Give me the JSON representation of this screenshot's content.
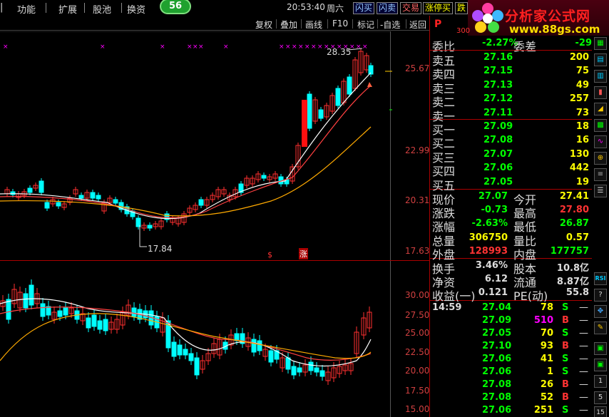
{
  "menu": {
    "items": [
      "功能",
      "扩展",
      "股池",
      "换资"
    ],
    "badge": "56",
    "clock": "20:53:40",
    "weekday": "周六"
  },
  "trade_buttons": [
    "闪买",
    "闪卖",
    "交易",
    "涨停买",
    "跌"
  ],
  "logo": {
    "title": "分析家公式网",
    "url": "www.88gs.com"
  },
  "toolbar": [
    "复权",
    "叠加",
    "画线",
    "F10",
    "标记",
    "-自选",
    "返回"
  ],
  "price_chart": {
    "y_ticks": [
      "25.67",
      "22.99",
      "20.31",
      "17.63"
    ],
    "high_label": "28.35",
    "low_label": "17.84",
    "markers": [
      "$",
      "涨"
    ]
  },
  "sub_chart": {
    "y_ticks": [
      "30.00",
      "27.50",
      "25.00",
      "22.50",
      "20.00",
      "17.50",
      "15.00"
    ]
  },
  "chart_data": {
    "type": "candlestick",
    "title": "",
    "ylim": [
      17.63,
      28.35
    ],
    "high": 28.35,
    "low": 17.84
  },
  "colors": {
    "up": "#ff3030",
    "down": "#00ffff",
    "ma_white": "#ffffff",
    "ma_yellow": "#ffcc00",
    "ma_red": "#ff4040"
  },
  "panel": {
    "code_label": "P",
    "price_hint": "300",
    "weibi": {
      "label": "委比",
      "value": "-2.27%",
      "label2": "委差",
      "value2": "-29"
    },
    "asks": [
      {
        "label": "卖五",
        "price": "27.16",
        "vol": "200"
      },
      {
        "label": "卖四",
        "price": "27.15",
        "vol": "75"
      },
      {
        "label": "卖三",
        "price": "27.13",
        "vol": "49"
      },
      {
        "label": "卖二",
        "price": "27.12",
        "vol": "257"
      },
      {
        "label": "卖一",
        "price": "27.11",
        "vol": "73"
      }
    ],
    "bids": [
      {
        "label": "买一",
        "price": "27.09",
        "vol": "18"
      },
      {
        "label": "买二",
        "price": "27.08",
        "vol": "16"
      },
      {
        "label": "买三",
        "price": "27.07",
        "vol": "130"
      },
      {
        "label": "买四",
        "price": "27.06",
        "vol": "442"
      },
      {
        "label": "买五",
        "price": "27.05",
        "vol": "19"
      }
    ],
    "stats": [
      {
        "l1": "现价",
        "v1": "27.07",
        "l2": "今开",
        "v2": "27.41"
      },
      {
        "l1": "涨跌",
        "v1": "-0.73",
        "l2": "最高",
        "v2": "27.80"
      },
      {
        "l1": "涨幅",
        "v1": "-2.63%",
        "l2": "最低",
        "v2": "26.87"
      },
      {
        "l1": "总量",
        "v1": "306750",
        "l2": "量比",
        "v2": "0.57"
      },
      {
        "l1": "外盘",
        "v1": "128993",
        "l2": "内盘",
        "v2": "177757"
      }
    ],
    "fund": [
      {
        "l1": "换手",
        "v1": "3.46%",
        "l2": "股本",
        "v2": "10.8亿"
      },
      {
        "l1": "净资",
        "v1": "6.12",
        "l2": "流通",
        "v2": "8.87亿"
      },
      {
        "l1": "收益(一)",
        "v1": "0.121",
        "l2": "PE(动)",
        "v2": "55.8"
      }
    ],
    "ticks": [
      {
        "t": "14:59",
        "p": "27.04",
        "v": "78",
        "s": "S"
      },
      {
        "t": "",
        "p": "27.09",
        "v": "510",
        "s": "B"
      },
      {
        "t": "",
        "p": "27.05",
        "v": "70",
        "s": "S"
      },
      {
        "t": "",
        "p": "27.10",
        "v": "93",
        "s": "B"
      },
      {
        "t": "",
        "p": "27.06",
        "v": "41",
        "s": "S"
      },
      {
        "t": "",
        "p": "27.06",
        "v": "1",
        "s": "S"
      },
      {
        "t": "",
        "p": "27.08",
        "v": "26",
        "s": "B"
      },
      {
        "t": "",
        "p": "27.08",
        "v": "52",
        "s": "B"
      },
      {
        "t": "",
        "p": "27.06",
        "v": "251",
        "s": "S"
      }
    ]
  },
  "right_toolbar": [
    "RSI",
    "1",
    "5",
    "15"
  ]
}
